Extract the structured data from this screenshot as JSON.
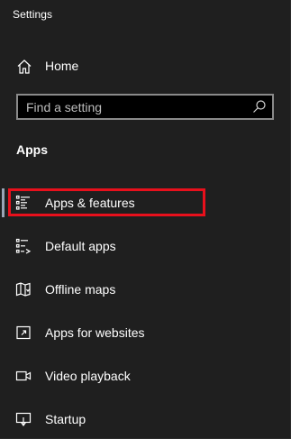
{
  "window": {
    "title": "Settings"
  },
  "home": {
    "label": "Home",
    "icon": "home-icon"
  },
  "search": {
    "placeholder": "Find a setting",
    "value": "",
    "icon": "search-icon"
  },
  "section": {
    "title": "Apps"
  },
  "nav": {
    "items": [
      {
        "label": "Apps & features",
        "icon": "apps-features-icon",
        "selected": true
      },
      {
        "label": "Default apps",
        "icon": "default-apps-icon",
        "selected": false
      },
      {
        "label": "Offline maps",
        "icon": "map-icon",
        "selected": false
      },
      {
        "label": "Apps for websites",
        "icon": "apps-for-websites-icon",
        "selected": false
      },
      {
        "label": "Video playback",
        "icon": "video-icon",
        "selected": false
      },
      {
        "label": "Startup",
        "icon": "startup-icon",
        "selected": false
      }
    ]
  },
  "colors": {
    "background": "#1f1f1f",
    "text": "#ffffff",
    "selection_indicator": "#9aa5b5",
    "annotation_highlight": "#e8101c",
    "search_border": "#8a8a8a"
  }
}
